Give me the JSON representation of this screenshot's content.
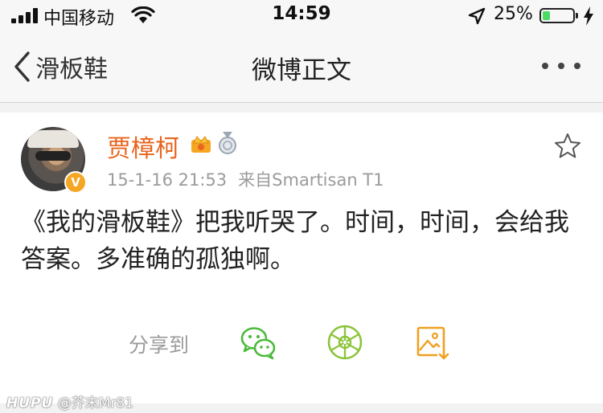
{
  "status_bar": {
    "carrier": "中国移动",
    "time": "14:59",
    "battery_pct": "25%",
    "battery_level": 0.25,
    "icons": [
      "signal-icon",
      "wifi-icon",
      "location-arrow-icon",
      "battery-icon",
      "charging-icon"
    ]
  },
  "nav": {
    "back_label": "滑板鞋",
    "title": "微博正文",
    "more_icon": "more-dots-icon"
  },
  "post": {
    "username": "贾樟柯",
    "timestamp": "15-1-16 21:53",
    "source": "来自Smartisan T1",
    "text": "《我的滑板鞋》把我听哭了。时间，时间，会给我答案。多准确的孤独啊。",
    "badges": [
      "vip-crown-icon",
      "medal-icon",
      "verified-badge"
    ],
    "verified_mark": "V"
  },
  "share": {
    "label": "分享到",
    "targets": [
      "wechat-icon",
      "moments-icon",
      "save-image-icon"
    ]
  },
  "watermark": {
    "logo": "HUPU",
    "handle": "@芥末Mr81"
  },
  "colors": {
    "username": "#e8651e",
    "meta": "#9b9b9b",
    "wechat": "#4cba3c",
    "moments": "#8cc43c",
    "save_image": "#f0a020",
    "battery": "#4cd964"
  }
}
